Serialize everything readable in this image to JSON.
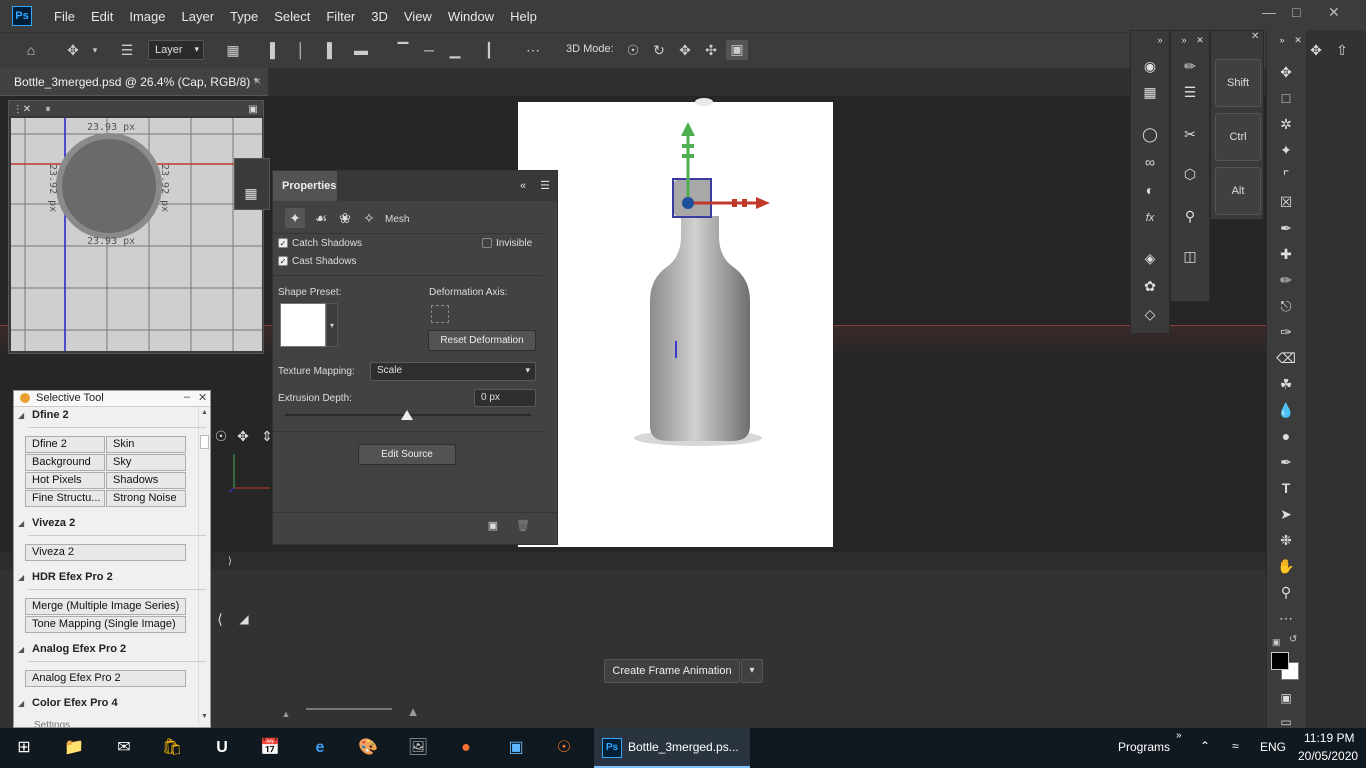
{
  "app": {
    "logo": "Ps"
  },
  "menu": [
    "File",
    "Edit",
    "Image",
    "Layer",
    "Type",
    "Select",
    "Filter",
    "3D",
    "View",
    "Window",
    "Help"
  ],
  "options_bar": {
    "layer_select": "Layer",
    "mode3d_label": "3D Mode:"
  },
  "document": {
    "tab_title": "Bottle_3merged.psd @ 26.4% (Cap, RGB/8) *",
    "close": "×"
  },
  "navigator": {
    "dim_top": "23.93 px",
    "dim_bottom": "23.93 px",
    "dim_left": "23.92 px",
    "dim_right": "23.92 px"
  },
  "properties": {
    "title": "Properties",
    "tab_mesh": "Mesh",
    "catch_shadows": "Catch Shadows",
    "cast_shadows": "Cast Shadows",
    "invisible": "Invisible",
    "shape_preset": "Shape Preset:",
    "deformation_axis": "Deformation Axis:",
    "reset_deformation": "Reset Deformation",
    "texture_mapping_label": "Texture Mapping:",
    "texture_mapping_value": "Scale",
    "extrusion_depth_label": "Extrusion Depth:",
    "extrusion_depth_value": "0 px",
    "edit_source": "Edit Source"
  },
  "selective_tool": {
    "title": "Selective Tool",
    "sections": [
      {
        "name": "Dfine 2",
        "buttons": [
          "Dfine 2",
          "Skin",
          "Background",
          "Sky",
          "Hot Pixels",
          "Shadows",
          "Fine Structu...",
          "Strong Noise"
        ]
      },
      {
        "name": "Viveza 2",
        "buttons": [
          "Viveza 2"
        ]
      },
      {
        "name": "HDR Efex Pro 2",
        "buttons": [
          "Merge (Multiple Image Series)",
          "Tone Mapping (Single Image)"
        ]
      },
      {
        "name": "Analog Efex Pro 2",
        "buttons": [
          "Analog Efex Pro 2"
        ]
      },
      {
        "name": "Color Efex Pro 4",
        "buttons": []
      }
    ],
    "footer": "Settings"
  },
  "modifier_keys": [
    "Shift",
    "Ctrl",
    "Alt"
  ],
  "timeline": {
    "create_button": "Create Frame Animation"
  },
  "taskbar": {
    "active_app_label": "Bottle_3merged.ps...",
    "programs": "Programs",
    "language": "ENG",
    "time": "11:19 PM",
    "date": "20/05/2020"
  },
  "colors": {
    "accent": "#31a8ff",
    "canvas": "#ffffff",
    "gizmo_x": "#c0392b",
    "gizmo_y": "#4caf50"
  }
}
